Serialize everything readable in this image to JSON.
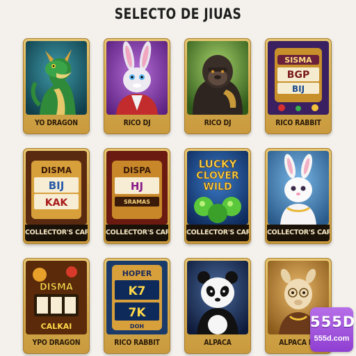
{
  "header": {
    "title": "SELECTO DE JIUAS"
  },
  "cards": [
    {
      "label": "YO DRAGON",
      "art_icon": "green-dragon"
    },
    {
      "label": "RICO DJ",
      "art_icon": "rabbit-dj"
    },
    {
      "label": "RICO DJ",
      "art_icon": "gorilla"
    },
    {
      "label": "RICO RABBIT",
      "art_icon": "slot-machine",
      "art_text": [
        "SISMA",
        "BGP",
        "BIJ"
      ]
    },
    {
      "label": "COLLECTOR'S CARD",
      "art_icon": "slot-machine",
      "art_text": [
        "DISMA",
        "BIJ",
        "KAK"
      ]
    },
    {
      "label": "COLLECTOR'S CARD",
      "art_icon": "slot-machine",
      "art_text": [
        "DISPA",
        "HJ",
        "SRAMAS"
      ]
    },
    {
      "label": "COLLECTOR'S CARD",
      "art_icon": "lucky-clover-wild",
      "art_text": [
        "LUCKY",
        "CLOVER",
        "WILD"
      ]
    },
    {
      "label": "COLLECTOR'S CARD",
      "art_icon": "white-rabbit"
    },
    {
      "label": "YPO DRAGON",
      "art_icon": "slot-machine",
      "art_text": [
        "DISMA",
        "CALKAI"
      ]
    },
    {
      "label": "RICO RABBIT",
      "art_icon": "slot-machine",
      "art_text": [
        "HOPER",
        "K7",
        "7K",
        "DOH"
      ]
    },
    {
      "label": "ALPACA",
      "art_icon": "panda"
    },
    {
      "label": "ALPACA PA",
      "art_icon": "alpaca"
    }
  ],
  "brand": {
    "name": "555D",
    "domain": "555d.com",
    "color": "#9b4ddb"
  }
}
